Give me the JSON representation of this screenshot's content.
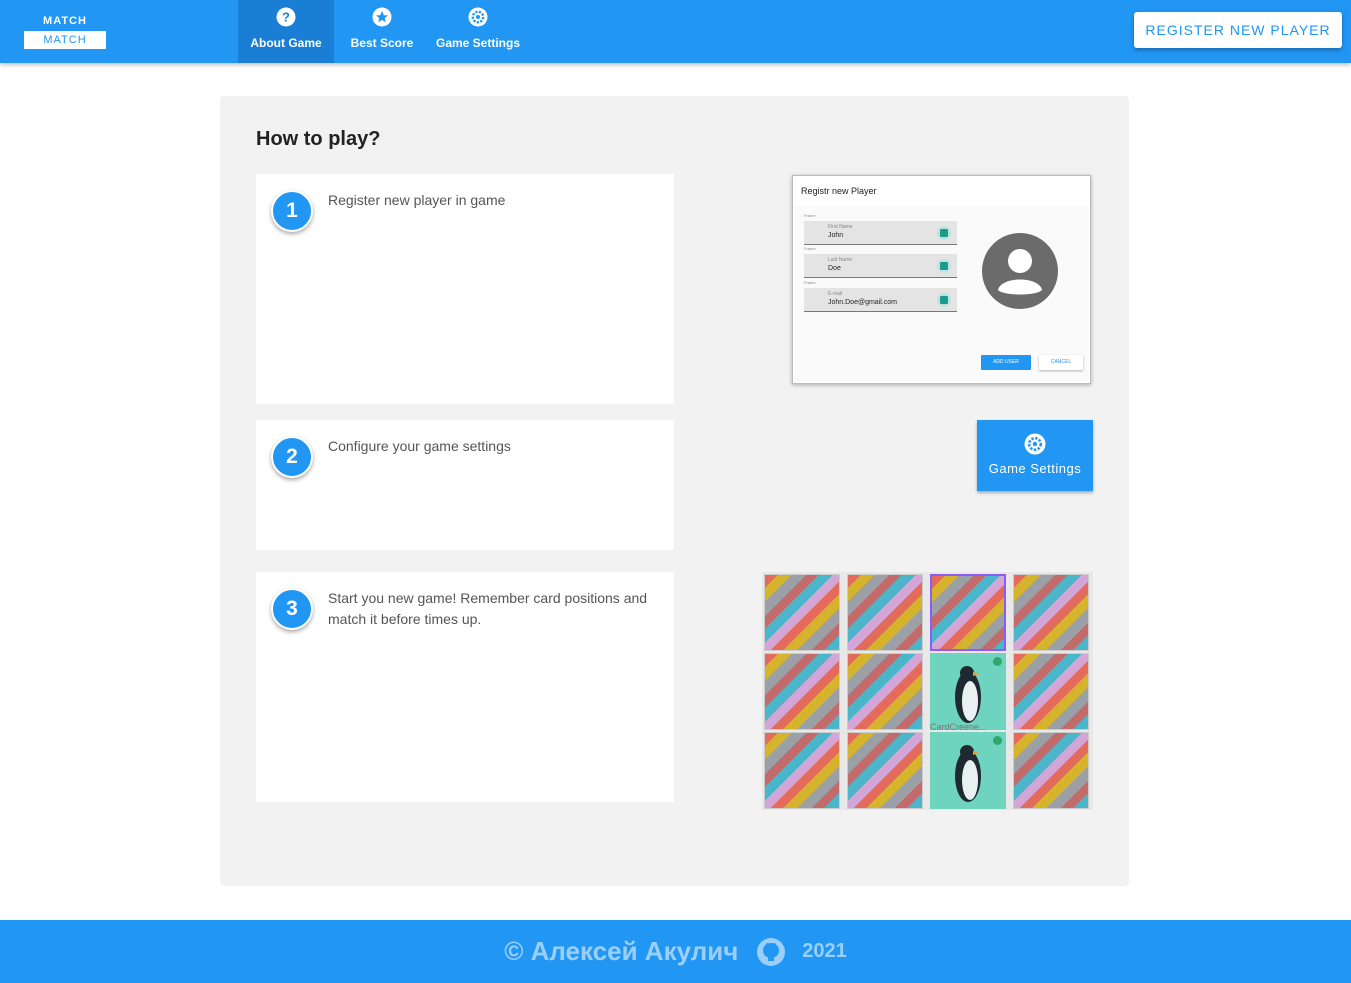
{
  "header": {
    "logo_top": "MATCH",
    "logo_bottom": "MATCH",
    "nav": [
      {
        "label": "About Game",
        "icon": "question-icon",
        "active": true
      },
      {
        "label": "Best Score",
        "icon": "star-icon",
        "active": false
      },
      {
        "label": "Game Settings",
        "icon": "gear-icon",
        "active": false
      }
    ],
    "register_button": "REGISTER NEW PLAYER"
  },
  "main": {
    "title": "How to play?",
    "steps": [
      {
        "number": "1",
        "text": "Register new player in game"
      },
      {
        "number": "2",
        "text": "Configure your game settings"
      },
      {
        "number": "3",
        "text": "Start you new game! Remember card positions and match it before times up."
      }
    ]
  },
  "register_preview": {
    "title": "Registr new Player",
    "fields": [
      {
        "frame_label": "Frame",
        "label": "First Name",
        "value": "John"
      },
      {
        "frame_label": "Frame",
        "label": "Last Name",
        "value": "Doe"
      },
      {
        "frame_label": "Frame",
        "label": "E-mail",
        "value": "John.Doe@gmail.com"
      }
    ],
    "add_button": "ADD USER",
    "cancel_button": "CANCEL"
  },
  "settings_preview": {
    "label": "Game Settings",
    "icon": "gear-icon"
  },
  "card_preview": {
    "label": "CardCreene..."
  },
  "footer": {
    "author": "© Алексей Акулич",
    "icon": "github-icon",
    "year": "2021"
  },
  "colors": {
    "primary": "#2196f3",
    "panel": "#f2f2f2",
    "card_selected": "#8b5cf6",
    "card_matched": "#6ed4bf"
  }
}
